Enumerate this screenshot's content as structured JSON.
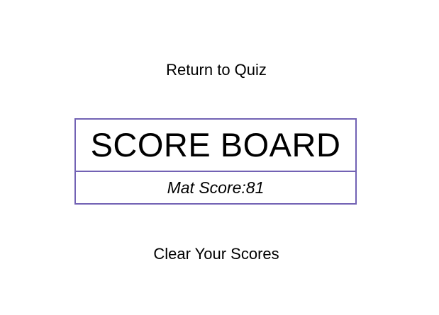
{
  "nav": {
    "return_label": "Return to Quiz"
  },
  "scoreboard": {
    "title": "SCORE BOARD",
    "entries": [
      {
        "text": "Mat Score:81"
      }
    ]
  },
  "actions": {
    "clear_label": "Clear Your Scores"
  },
  "colors": {
    "border": "#7262b4",
    "background": "#ffffff",
    "text": "#000000"
  }
}
